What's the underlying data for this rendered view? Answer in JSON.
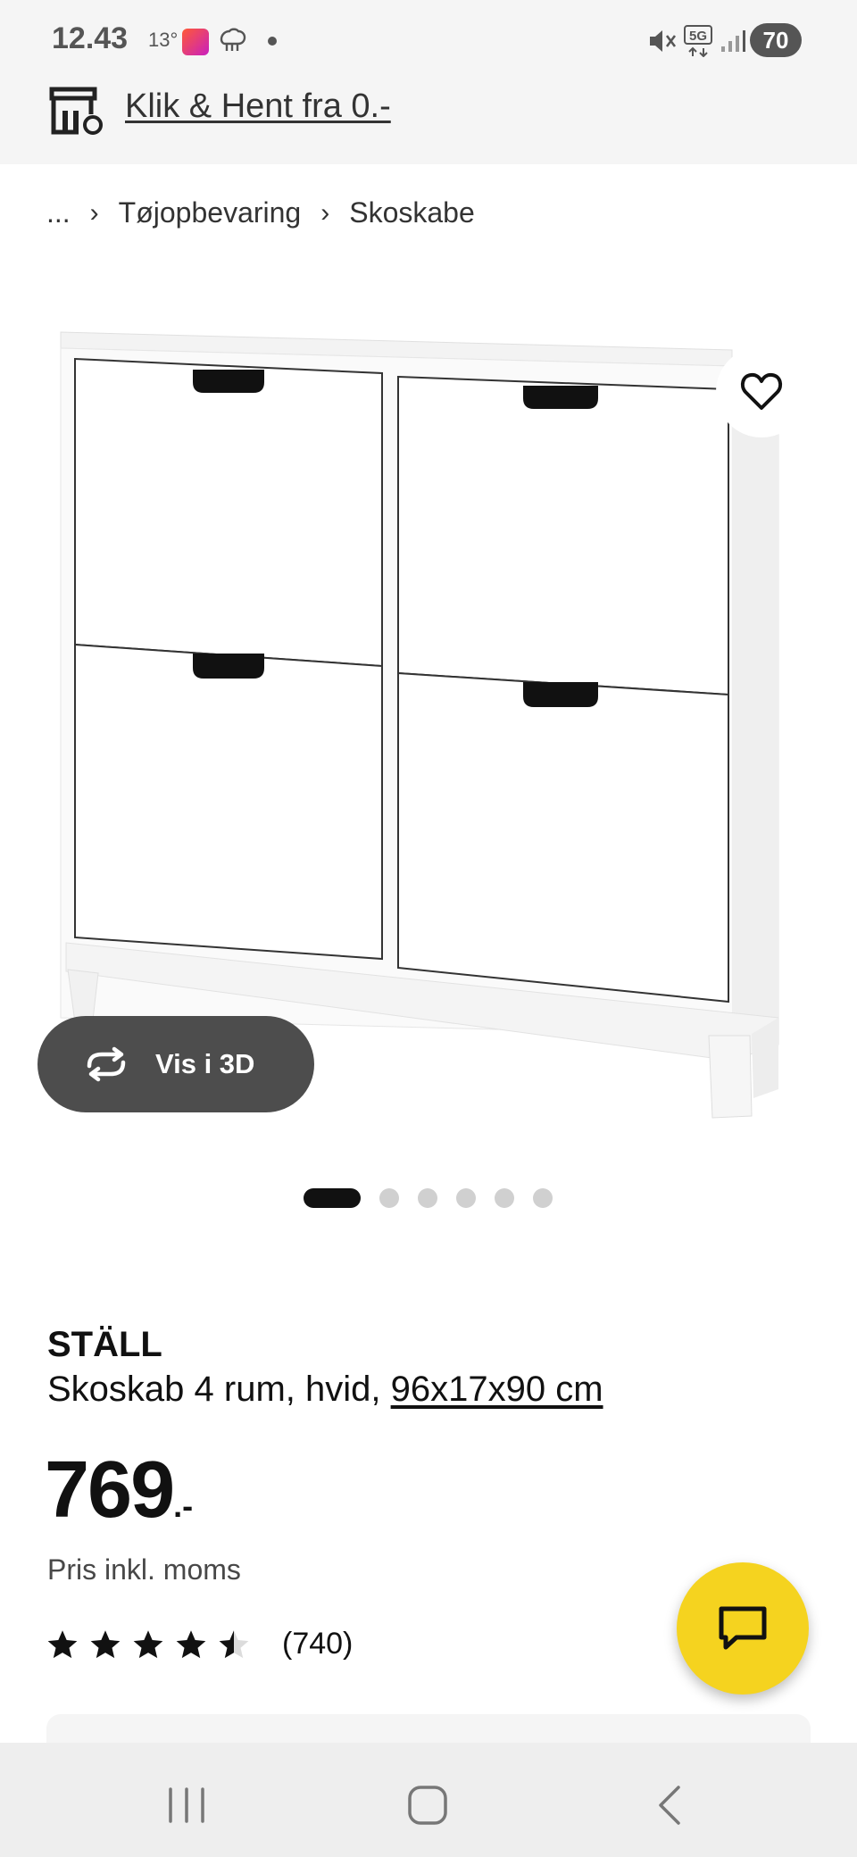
{
  "status_bar": {
    "time": "12.43",
    "temperature": "13°",
    "battery": "70",
    "network": "5G",
    "icons": [
      "app-notification-icon",
      "sheep-icon",
      "dot-icon",
      "mute-icon",
      "5g-icon",
      "signal-icon",
      "battery-icon"
    ]
  },
  "pickup_banner": {
    "icon": "store-icon",
    "link_text": "Klik & Hent fra 0.-"
  },
  "breadcrumb": {
    "items": [
      "...",
      "Tøjopbevaring",
      "Skoskabe"
    ],
    "separator": "›"
  },
  "product_image": {
    "view_3d_label": "Vis i 3D",
    "wishlist_icon": "heart-icon"
  },
  "carousel": {
    "count": 6,
    "active_index": 0
  },
  "product": {
    "name": "STÄLL",
    "description": "Skoskab 4 rum, hvid, ",
    "dimensions": "96x17x90 cm",
    "price": "769",
    "price_suffix": ".-",
    "price_note": "Pris inkl. moms",
    "rating": 4.5,
    "rating_max": 5,
    "review_count": "(740)"
  },
  "chat_button": {
    "icon": "chat-icon",
    "color": "#f5d31f"
  },
  "nav_bar": {
    "icons": [
      "recents-icon",
      "home-icon",
      "back-icon"
    ]
  },
  "colors": {
    "accent_yellow": "#f5d31f",
    "dark_pill": "#4d4d4d",
    "text": "#111111"
  }
}
